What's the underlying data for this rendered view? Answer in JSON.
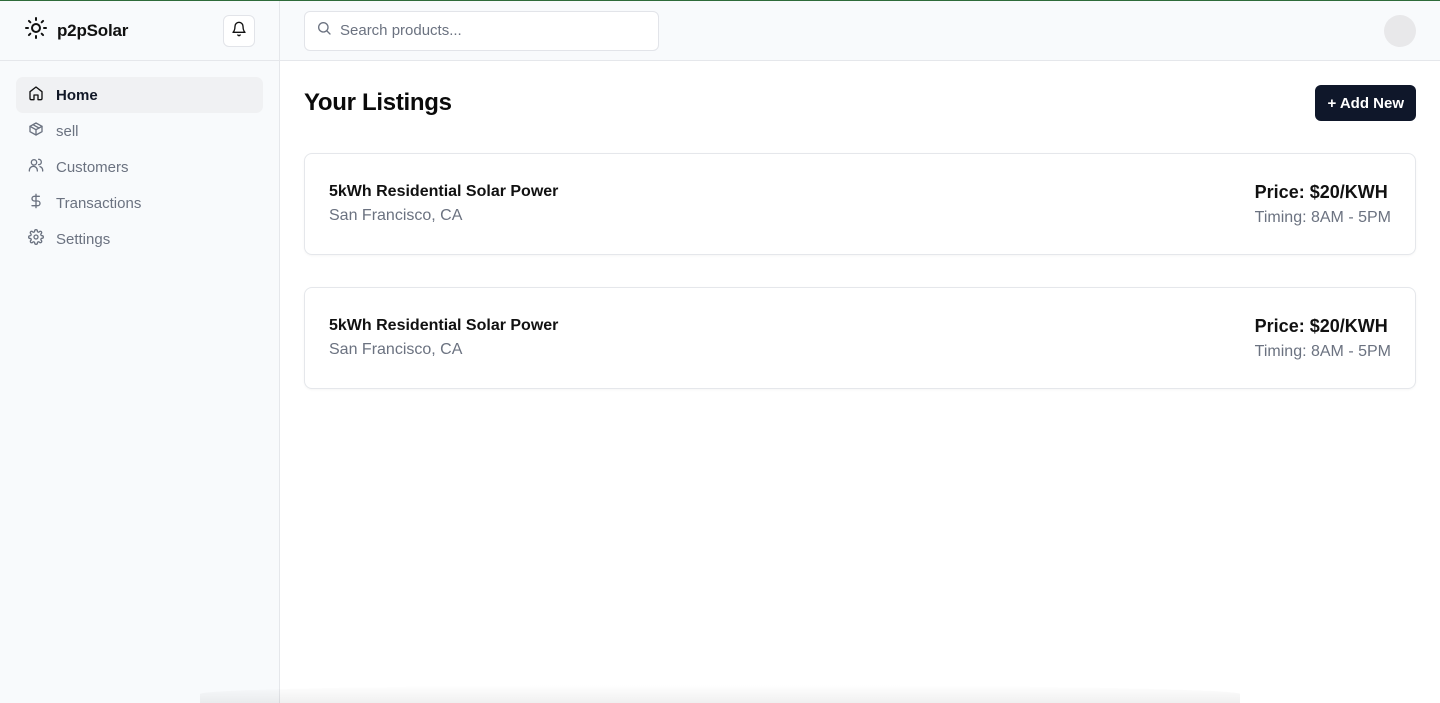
{
  "brand": {
    "name": "p2pSolar"
  },
  "sidebar": {
    "items": [
      {
        "label": "Home",
        "icon": "home-icon",
        "active": true
      },
      {
        "label": "sell",
        "icon": "package-icon",
        "active": false
      },
      {
        "label": "Customers",
        "icon": "users-icon",
        "active": false
      },
      {
        "label": "Transactions",
        "icon": "dollar-icon",
        "active": false
      },
      {
        "label": "Settings",
        "icon": "gear-icon",
        "active": false
      }
    ]
  },
  "search": {
    "placeholder": "Search products..."
  },
  "main": {
    "title": "Your Listings",
    "add_button_label": "+ Add New",
    "listings": [
      {
        "title": "5kWh Residential Solar Power",
        "location": "San Francisco, CA",
        "price": "Price: $20/KWH",
        "timing": "Timing: 8AM - 5PM"
      },
      {
        "title": "5kWh Residential Solar Power",
        "location": "San Francisco, CA",
        "price": "Price: $20/KWH",
        "timing": "Timing: 8AM - 5PM"
      }
    ]
  },
  "colors": {
    "primary_button": "#0f172a",
    "sidebar_bg": "#f8fafc",
    "muted_text": "#6b7280",
    "top_border": "#2e6b3a"
  }
}
